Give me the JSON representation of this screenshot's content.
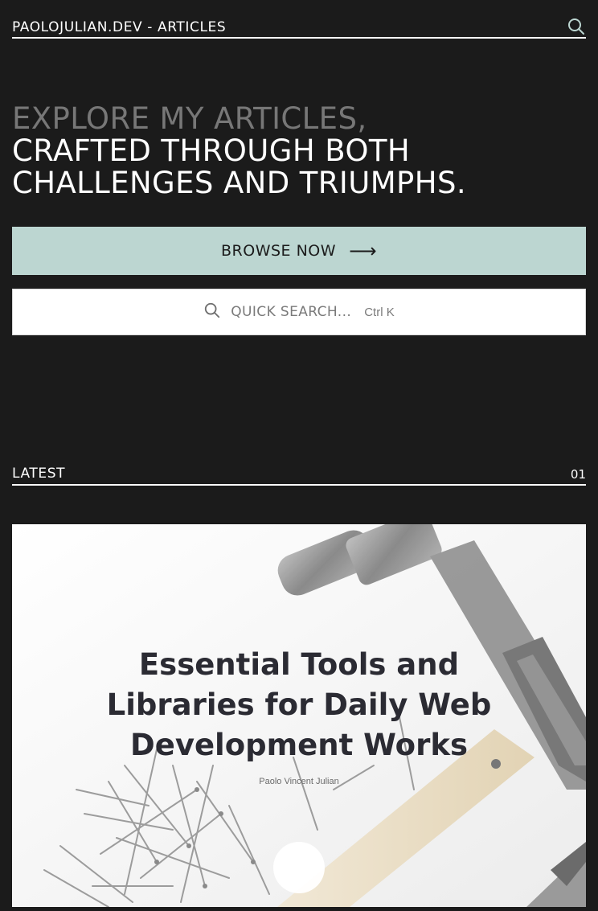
{
  "header": {
    "site_title": "PAOLOJULIAN.DEV - ARTICLES",
    "search_icon": "search-icon"
  },
  "hero": {
    "line1": "EXPLORE MY ARTICLES,",
    "line2": "CRAFTED THROUGH BOTH",
    "line3": "CHALLENGES AND TRIUMPHS."
  },
  "browse": {
    "label": "BROWSE NOW",
    "arrow": "⟶"
  },
  "quick_search": {
    "placeholder": "QUICK SEARCH...",
    "shortcut": "Ctrl K",
    "icon": "search-icon"
  },
  "latest": {
    "label": "LATEST",
    "count": "01"
  },
  "article": {
    "title_lines": [
      "Essential Tools and",
      "Libraries for Daily Web",
      "Development Works"
    ],
    "author": "Paolo Vincent Julian"
  },
  "colors": {
    "background": "#1b1b1b",
    "accent": "#bcd6d1",
    "muted_text": "#777777"
  }
}
